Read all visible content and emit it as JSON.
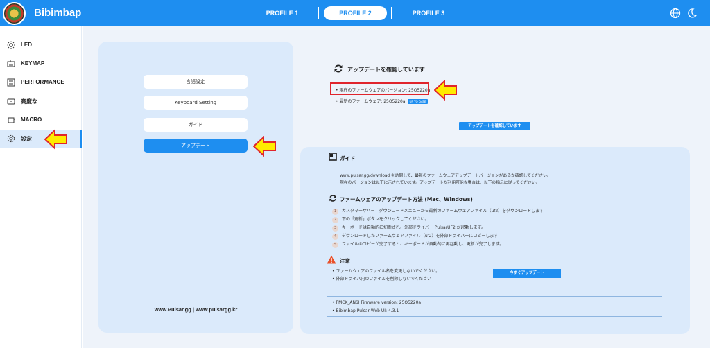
{
  "header": {
    "brand": "Bibimbap",
    "tabs": [
      "PROFILE 1",
      "PROFILE 2",
      "PROFILE 3"
    ],
    "active_tab": 1,
    "icons": [
      "globe-icon",
      "moon-icon"
    ],
    "accent": "#1e8ef0"
  },
  "sidebar": {
    "items": [
      {
        "label": "LED",
        "icon": "sun-icon"
      },
      {
        "label": "KEYMAP",
        "icon": "keyboard-icon"
      },
      {
        "label": "PERFORMANCE",
        "icon": "sliders-icon"
      },
      {
        "label": "高度な",
        "icon": "advanced-icon"
      },
      {
        "label": "MACRO",
        "icon": "macro-icon"
      },
      {
        "label": "設定",
        "icon": "gear-icon"
      }
    ],
    "active_index": 5
  },
  "left_panel": {
    "buttons": [
      "言語設定",
      "Keyboard Setting",
      "ガイド",
      "アップデート"
    ],
    "footer": "www.Pulsar.gg | www.pulsargg.kr"
  },
  "update": {
    "title": "アップデートを確認しています",
    "current_fw": "• 現在のファームウェアのバージョン: 25O5220a",
    "latest_fw": "• 最新のファームウェア: 25O5220a",
    "badge": "UP TO DATE",
    "check_button": "アップデートを確認しています"
  },
  "guide": {
    "title": "ガイド",
    "intro_line1": "www.pulsar.gg/download を訪問して、最新のファームウェアアップデートバージョンがあるか確認してください。",
    "intro_line2": "現在のバージョンは以下に示されています。アップデートが利用可能な場合は、以下の指示に従ってください。",
    "method_title": "ファームウェアのアップデート方法 (Mac、Windows)",
    "steps": [
      "カスタマーサバー - ダウンロードメニューから最新のファームウェアファイル（uf2）をダウンロードします",
      "下の「更新」ボタンをクリックしてください。",
      "キーボードは自動的に切断され、外部ドライバー PulsarUF2 が起動します。",
      "ダウンロードしたファームウェアファイル（uf2）を外部ドライバーにコピーします",
      "ファイルのコピーが完了すると、キーボードが自動的に再起動し、更新が完了します。"
    ],
    "caution_title": "注意",
    "cautions": [
      "• ファームウェアのファイル名を変更しないでください。",
      "• 外部ドライバ内のファイルを削除しないでください"
    ],
    "update_now_button": "今すぐアップデート",
    "versions": [
      "• PMCK_ANSI Firmware version: 25O5220a",
      "• Bibimbap Pulsar Web UI: 4.3.1"
    ]
  }
}
